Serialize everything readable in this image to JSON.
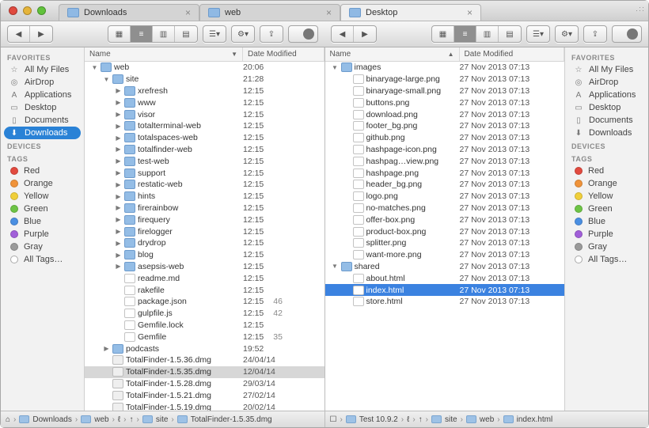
{
  "tabs": [
    {
      "label": "Downloads",
      "active": false
    },
    {
      "label": "web",
      "active": false
    },
    {
      "label": "Desktop",
      "active": true
    }
  ],
  "sidebar": {
    "favorites_head": "FAVORITES",
    "devices_head": "DEVICES",
    "tags_head": "TAGS",
    "favorites": [
      {
        "label": "All My Files",
        "icon": "star"
      },
      {
        "label": "AirDrop",
        "icon": "radar"
      },
      {
        "label": "Applications",
        "icon": "A"
      },
      {
        "label": "Desktop",
        "icon": "▭"
      },
      {
        "label": "Documents",
        "icon": "doc"
      },
      {
        "label": "Downloads",
        "icon": "↓",
        "sel": true
      }
    ],
    "tags": [
      {
        "label": "Red",
        "color": "#e24a3f"
      },
      {
        "label": "Orange",
        "color": "#f0933a"
      },
      {
        "label": "Yellow",
        "color": "#f0cf3a"
      },
      {
        "label": "Green",
        "color": "#6dc445"
      },
      {
        "label": "Blue",
        "color": "#4a8fe2"
      },
      {
        "label": "Purple",
        "color": "#a15fd9"
      },
      {
        "label": "Gray",
        "color": "#9a9a9a"
      },
      {
        "label": "All Tags…",
        "color": null
      }
    ]
  },
  "sidebar_right_favorites_sel": -1,
  "columns": {
    "name": "Name",
    "date": "Date Modified"
  },
  "left_rows": [
    {
      "d": 0,
      "disc": "down",
      "t": "folder",
      "name": "web",
      "date": "20:06"
    },
    {
      "d": 1,
      "disc": "down",
      "t": "folder",
      "name": "site",
      "date": "21:28"
    },
    {
      "d": 2,
      "disc": "right",
      "t": "folder",
      "name": "xrefresh",
      "date": "12:15"
    },
    {
      "d": 2,
      "disc": "right",
      "t": "folder",
      "name": "www",
      "date": "12:15"
    },
    {
      "d": 2,
      "disc": "right",
      "t": "folder",
      "name": "visor",
      "date": "12:15"
    },
    {
      "d": 2,
      "disc": "right",
      "t": "folder",
      "name": "totalterminal-web",
      "date": "12:15"
    },
    {
      "d": 2,
      "disc": "right",
      "t": "folder",
      "name": "totalspaces-web",
      "date": "12:15"
    },
    {
      "d": 2,
      "disc": "right",
      "t": "folder",
      "name": "totalfinder-web",
      "date": "12:15"
    },
    {
      "d": 2,
      "disc": "right",
      "t": "folder",
      "name": "test-web",
      "date": "12:15"
    },
    {
      "d": 2,
      "disc": "right",
      "t": "folder",
      "name": "support",
      "date": "12:15"
    },
    {
      "d": 2,
      "disc": "right",
      "t": "folder",
      "name": "restatic-web",
      "date": "12:15"
    },
    {
      "d": 2,
      "disc": "right",
      "t": "folder",
      "name": "hints",
      "date": "12:15"
    },
    {
      "d": 2,
      "disc": "right",
      "t": "folder",
      "name": "firerainbow",
      "date": "12:15"
    },
    {
      "d": 2,
      "disc": "right",
      "t": "folder",
      "name": "firequery",
      "date": "12:15"
    },
    {
      "d": 2,
      "disc": "right",
      "t": "folder",
      "name": "firelogger",
      "date": "12:15"
    },
    {
      "d": 2,
      "disc": "right",
      "t": "folder",
      "name": "drydrop",
      "date": "12:15"
    },
    {
      "d": 2,
      "disc": "right",
      "t": "folder",
      "name": "blog",
      "date": "12:15"
    },
    {
      "d": 2,
      "disc": "right",
      "t": "folder",
      "name": "asepsis-web",
      "date": "12:15"
    },
    {
      "d": 2,
      "disc": "",
      "t": "file",
      "name": "readme.md",
      "date": "12:15"
    },
    {
      "d": 2,
      "disc": "",
      "t": "file",
      "name": "rakefile",
      "date": "12:15"
    },
    {
      "d": 2,
      "disc": "",
      "t": "file",
      "name": "package.json",
      "date": "12:15",
      "extra": "46"
    },
    {
      "d": 2,
      "disc": "",
      "t": "file",
      "name": "gulpfile.js",
      "date": "12:15",
      "extra": "42"
    },
    {
      "d": 2,
      "disc": "",
      "t": "file",
      "name": "Gemfile.lock",
      "date": "12:15"
    },
    {
      "d": 2,
      "disc": "",
      "t": "file",
      "name": "Gemfile",
      "date": "12:15",
      "extra": "35"
    },
    {
      "d": 1,
      "disc": "right",
      "t": "folder",
      "name": "podcasts",
      "date": "19:52"
    },
    {
      "d": 1,
      "disc": "",
      "t": "dmg",
      "name": "TotalFinder-1.5.36.dmg",
      "date": "24/04/14"
    },
    {
      "d": 1,
      "disc": "",
      "t": "dmg",
      "name": "TotalFinder-1.5.35.dmg",
      "date": "12/04/14",
      "sel": "gray"
    },
    {
      "d": 1,
      "disc": "",
      "t": "dmg",
      "name": "TotalFinder-1.5.28.dmg",
      "date": "29/03/14"
    },
    {
      "d": 1,
      "disc": "",
      "t": "dmg",
      "name": "TotalFinder-1.5.21.dmg",
      "date": "27/02/14"
    },
    {
      "d": 1,
      "disc": "",
      "t": "dmg",
      "name": "TotalFinder-1.5.19.dmg",
      "date": "20/02/14"
    }
  ],
  "right_rows": [
    {
      "d": 0,
      "disc": "down",
      "t": "folder",
      "name": "images",
      "date": "27 Nov 2013 07:13"
    },
    {
      "d": 1,
      "disc": "",
      "t": "png",
      "name": "binaryage-large.png",
      "date": "27 Nov 2013 07:13"
    },
    {
      "d": 1,
      "disc": "",
      "t": "png",
      "name": "binaryage-small.png",
      "date": "27 Nov 2013 07:13"
    },
    {
      "d": 1,
      "disc": "",
      "t": "png",
      "name": "buttons.png",
      "date": "27 Nov 2013 07:13"
    },
    {
      "d": 1,
      "disc": "",
      "t": "png",
      "name": "download.png",
      "date": "27 Nov 2013 07:13"
    },
    {
      "d": 1,
      "disc": "",
      "t": "png",
      "name": "footer_bg.png",
      "date": "27 Nov 2013 07:13"
    },
    {
      "d": 1,
      "disc": "",
      "t": "png",
      "name": "github.png",
      "date": "27 Nov 2013 07:13"
    },
    {
      "d": 1,
      "disc": "",
      "t": "png",
      "name": "hashpage-icon.png",
      "date": "27 Nov 2013 07:13"
    },
    {
      "d": 1,
      "disc": "",
      "t": "png",
      "name": "hashpag…view.png",
      "date": "27 Nov 2013 07:13"
    },
    {
      "d": 1,
      "disc": "",
      "t": "png",
      "name": "hashpage.png",
      "date": "27 Nov 2013 07:13"
    },
    {
      "d": 1,
      "disc": "",
      "t": "png",
      "name": "header_bg.png",
      "date": "27 Nov 2013 07:13"
    },
    {
      "d": 1,
      "disc": "",
      "t": "png",
      "name": "logo.png",
      "date": "27 Nov 2013 07:13"
    },
    {
      "d": 1,
      "disc": "",
      "t": "png",
      "name": "no-matches.png",
      "date": "27 Nov 2013 07:13"
    },
    {
      "d": 1,
      "disc": "",
      "t": "png",
      "name": "offer-box.png",
      "date": "27 Nov 2013 07:13"
    },
    {
      "d": 1,
      "disc": "",
      "t": "png",
      "name": "product-box.png",
      "date": "27 Nov 2013 07:13"
    },
    {
      "d": 1,
      "disc": "",
      "t": "png",
      "name": "splitter.png",
      "date": "27 Nov 2013 07:13"
    },
    {
      "d": 1,
      "disc": "",
      "t": "png",
      "name": "want-more.png",
      "date": "27 Nov 2013 07:13"
    },
    {
      "d": 0,
      "disc": "down",
      "t": "folder",
      "name": "shared",
      "date": "27 Nov 2013 07:13"
    },
    {
      "d": 1,
      "disc": "",
      "t": "file",
      "name": "about.html",
      "date": "27 Nov 2013 07:13"
    },
    {
      "d": 1,
      "disc": "",
      "t": "file",
      "name": "index.html",
      "date": "27 Nov 2013 07:13",
      "sel": "blue"
    },
    {
      "d": 1,
      "disc": "",
      "t": "file",
      "name": "store.html",
      "date": "27 Nov 2013 07:13"
    }
  ],
  "path_left": [
    "Downloads",
    "web",
    "ℓ",
    "↑",
    "site",
    "TotalFinder-1.5.35.dmg"
  ],
  "path_right": [
    "Test 10.9.2",
    "ℓ",
    "↑",
    "site",
    "web",
    "index.html"
  ],
  "path_left_prefix": "⌂",
  "path_right_prefix": "☐",
  "colw": {
    "left_name": 200,
    "left_date": 90,
    "right_name": 170,
    "right_date": 130
  }
}
